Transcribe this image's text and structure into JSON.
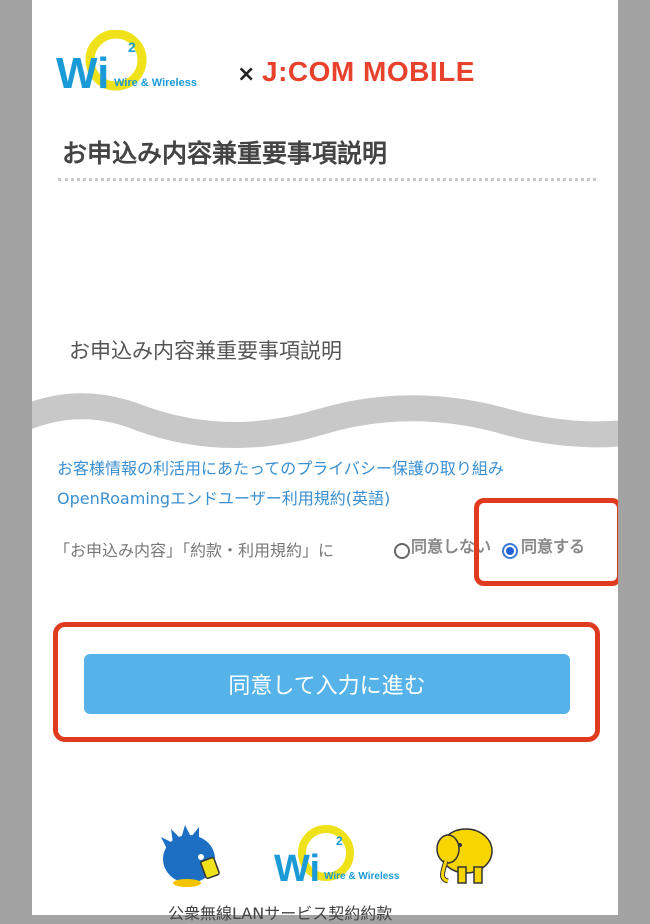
{
  "header": {
    "wi2_logo_sub": "Wire & Wireless",
    "cross": "×",
    "partner_name": "J:COM MOBILE"
  },
  "page": {
    "title": "お申込み内容兼重要事項説明",
    "section_title": "お申込み内容兼重要事項説明"
  },
  "links": [
    "お客様情報の利活用にあたってのプライバシー保護の取り組み",
    "OpenRoamingエンドユーザー利用規約(英語)"
  ],
  "agreement": {
    "label": "「お申込み内容」「約款・利用規約」に",
    "options": [
      "同意しない",
      "同意する"
    ],
    "selected": "同意する"
  },
  "cta": {
    "label": "同意して入力に進む"
  },
  "footer": {
    "wi2_logo_sub": "Wire & Wireless",
    "text": "公衆無線LANサービス契約約款"
  },
  "colors": {
    "accent_red": "#e03b1f",
    "link_blue": "#3a8fd0",
    "cta_blue": "#55b3ea",
    "logo_yellow": "#f0e21a",
    "logo_blue": "#1a9ad6"
  }
}
